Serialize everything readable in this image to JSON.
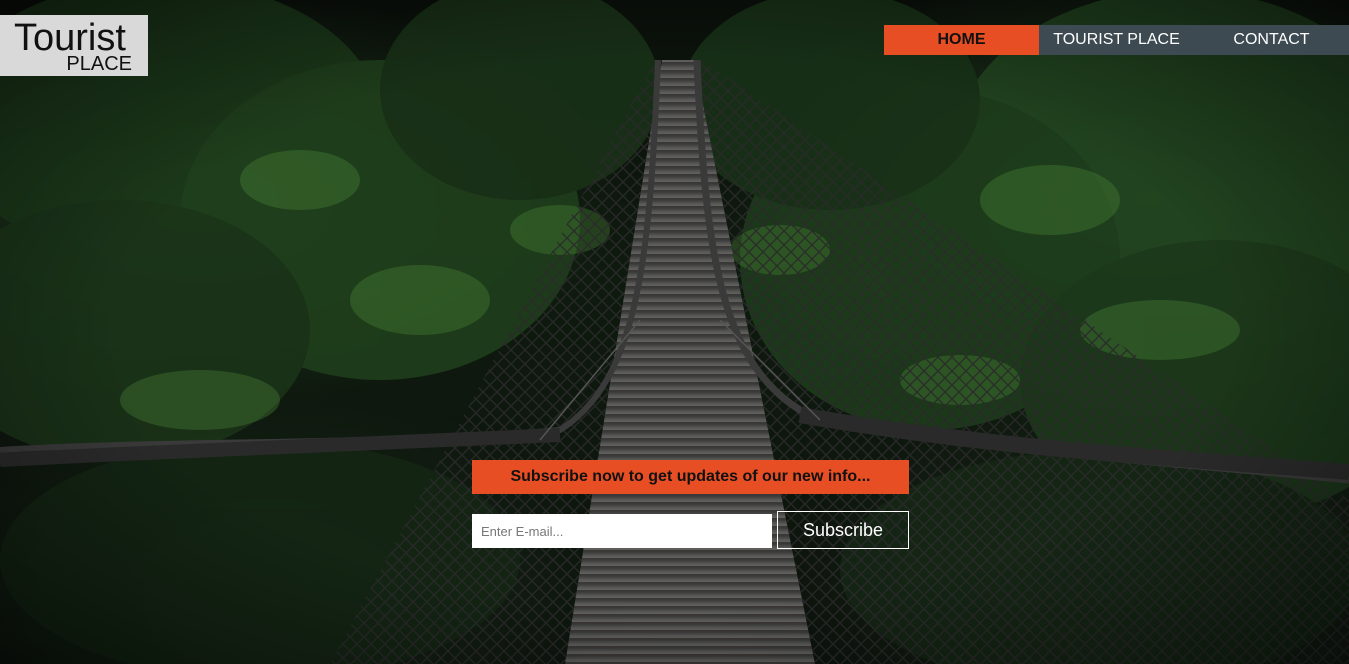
{
  "logo": {
    "title": "Tourist",
    "subtitle": "PLACE"
  },
  "nav": {
    "items": [
      {
        "label": "HOME",
        "active": true
      },
      {
        "label": "TOURIST PLACE",
        "active": false
      },
      {
        "label": "CONTACT",
        "active": false
      }
    ]
  },
  "subscribe": {
    "banner_text": "Subscribe now to get updates of our new info...",
    "email_placeholder": "Enter E-mail...",
    "button_label": "Subscribe"
  },
  "colors": {
    "accent": "#e84e23",
    "nav_background": "#3d4a52",
    "logo_background": "#d9d9d9"
  }
}
